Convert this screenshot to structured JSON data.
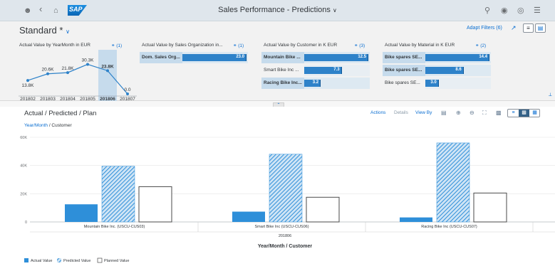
{
  "shell": {
    "title": "Sales Performance - Predictions",
    "logo": "SAP",
    "icons": [
      "person-icon",
      "back-icon",
      "home-icon",
      "search-icon",
      "help-icon",
      "notifications-icon",
      "menu-icon"
    ]
  },
  "header": {
    "variant": "Standard *",
    "adapt_filters": "Adapt Filters (6)"
  },
  "cards": [
    {
      "title": "Actual Value by YearMonth in EUR",
      "count": "(1)",
      "type": "line",
      "points": [
        {
          "x": "201802",
          "label": "13.8K",
          "value": 13.8
        },
        {
          "x": "201803",
          "label": "20.6K",
          "value": 20.6
        },
        {
          "x": "201804",
          "label": "21.8K",
          "value": 21.8
        },
        {
          "x": "201805",
          "label": "30.3K",
          "value": 30.3
        },
        {
          "x": "201806",
          "label": "23.8K",
          "value": 23.8
        },
        {
          "x": "201807",
          "label": "0.0",
          "value": 0.0
        }
      ],
      "selected": "201806"
    },
    {
      "title": "Actual Value by Sales Organization in...",
      "count": "(1)",
      "items": [
        {
          "label": "Dom. Sales Org...",
          "value": 23.0,
          "text": "23.0",
          "selected": true
        }
      ],
      "max": 23.0
    },
    {
      "title": "Actual Value by Customer in K EUR",
      "count": "(3)",
      "items": [
        {
          "label": "Mountain Bike ...",
          "value": 12.5,
          "text": "12.5",
          "selected": true
        },
        {
          "label": "Smart Bike Inc ...",
          "value": 7.3,
          "text": "7.3",
          "selected": false
        },
        {
          "label": "Racing Bike Inc...",
          "value": 3.2,
          "text": "3.2",
          "selected": true
        }
      ],
      "max": 12.5
    },
    {
      "title": "Actual Value by Material in K EUR",
      "count": "(2)",
      "items": [
        {
          "label": "Bike spares SE...",
          "value": 14.4,
          "text": "14.4",
          "selected": true
        },
        {
          "label": "Bike spares SE...",
          "value": 8.6,
          "text": "8.6",
          "selected": true
        },
        {
          "label": "Bike spares SE...",
          "value": 3.0,
          "text": "3.0",
          "selected": false
        }
      ],
      "max": 14.4
    }
  ],
  "content": {
    "title": "Actual / Predicted / Plan",
    "breadcrumb_link": "Year/Month",
    "breadcrumb_rest": " / Customer",
    "actions": "Actions",
    "details": "Details",
    "view_by": "View By"
  },
  "chart_data": {
    "type": "bar",
    "categories": [
      "Mountain Bike Inc. (USCU-CUS03)",
      "Smart Bike Inc (USCU-CUS06)",
      "Racing Bike Inc (USCU-CUS07)"
    ],
    "group_label": "201806",
    "xlabel": "Year/Month / Customer",
    "ylim": [
      0,
      60000
    ],
    "yticks": [
      "0",
      "20K",
      "40K",
      "60K"
    ],
    "series": [
      {
        "name": "Actual Value",
        "values": [
          12500,
          7300,
          3200
        ],
        "color": "#2e8fd9",
        "pattern": "solid"
      },
      {
        "name": "Predicted Value",
        "values": [
          39500,
          48000,
          56000
        ],
        "color": "#2e8fd9",
        "pattern": "hatch"
      },
      {
        "name": "Planned Value",
        "values": [
          25000,
          17500,
          20500
        ],
        "color": "#ffffff",
        "pattern": "outline"
      }
    ],
    "grid": true,
    "legend_position": "bottom-left"
  }
}
